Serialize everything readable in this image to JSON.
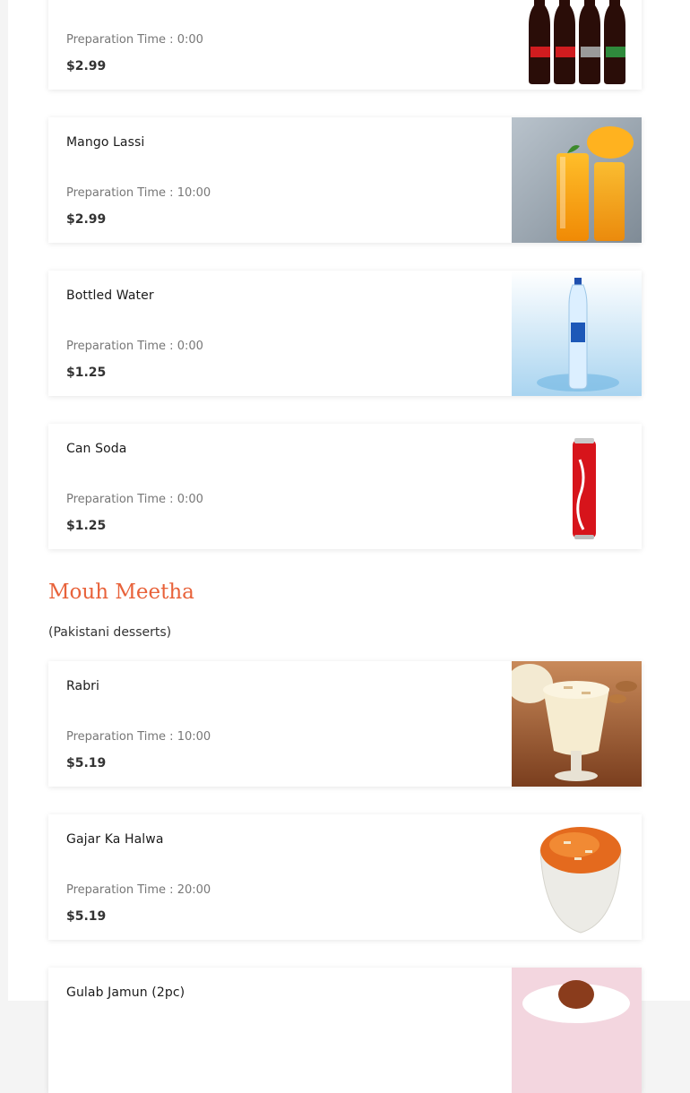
{
  "menu": {
    "drinks": [
      {
        "name": "",
        "prep_time": "Preparation Time : 0:00",
        "price": "$2.99",
        "image": "coca-cola-bottles"
      },
      {
        "name": "Mango Lassi",
        "prep_time": "Preparation Time : 10:00",
        "price": "$2.99",
        "image": "mango-lassi-glasses"
      },
      {
        "name": "Bottled Water",
        "prep_time": "Preparation Time : 0:00",
        "price": "$1.25",
        "image": "water-bottle-splash"
      },
      {
        "name": "Can Soda",
        "prep_time": "Preparation Time : 0:00",
        "price": "$1.25",
        "image": "coca-cola-can"
      }
    ],
    "dessert_section": {
      "title": "Mouh Meetha",
      "subtitle": "(Pakistani desserts)",
      "items": [
        {
          "name": "Rabri",
          "prep_time": "Preparation Time : 10:00",
          "price": "$5.19",
          "image": "rabri-glass"
        },
        {
          "name": "Gajar Ka Halwa",
          "prep_time": "Preparation Time : 20:00",
          "price": "$5.19",
          "image": "gajar-halwa-bowl"
        },
        {
          "name": "Gulab Jamun (2pc)",
          "prep_time": "",
          "price": "",
          "image": "gulab-jamun-plate"
        }
      ]
    }
  },
  "colors": {
    "section_title": "#e8623a",
    "page_bg": "#ffffff",
    "side_bg": "#f4f4f4"
  }
}
